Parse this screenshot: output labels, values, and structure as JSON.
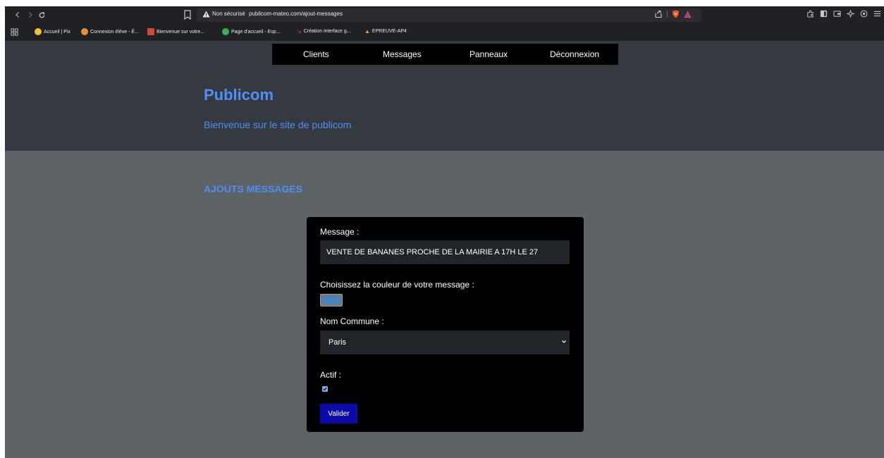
{
  "browser": {
    "security_label": "Non sécurisé",
    "url": "publicom-mateo.com/ajout-messages",
    "bookmarks": [
      {
        "label": "Accueil | Pix",
        "icon": "pix-icon",
        "color": "#f2c033"
      },
      {
        "label": "Connexion élève - É...",
        "icon": "user-icon",
        "color": "#e8913a"
      },
      {
        "label": "Bienvenue sur votre...",
        "icon": "site-icon",
        "color": "#d04a3a"
      },
      {
        "label": "Page d'accueil - Esp...",
        "icon": "ent-icon",
        "color": "#3fae5a"
      },
      {
        "label": "Création interface g...",
        "icon": "design-icon",
        "color": "#e0443e"
      },
      {
        "label": "EPREUVE-AP4",
        "icon": "drive-icon",
        "color": "#e9a23b"
      }
    ]
  },
  "nav": {
    "items": [
      "Clients",
      "Messages",
      "Panneaux",
      "Déconnexion"
    ]
  },
  "header": {
    "title": "Publicom",
    "subtitle": "Bienvenue sur le site de publicom"
  },
  "section": {
    "title": "AJOUTS MESSAGES"
  },
  "form": {
    "message_label": "Message :",
    "message_value": "VENTE DE BANANES PROCHE DE LA MAIRIE A 17H LE 27",
    "color_label": "Choisissez la couleur de votre message :",
    "color_value": "#4a83b8",
    "commune_label": "Nom Commune :",
    "commune_value": "Paris",
    "actif_label": "Actif :",
    "actif_checked": true,
    "submit_label": "Valider"
  },
  "colors": {
    "accent": "#4f8ff7",
    "hero_bg": "#343a40",
    "page_bg": "#5c6266",
    "button_bg": "#0b0ba8"
  }
}
